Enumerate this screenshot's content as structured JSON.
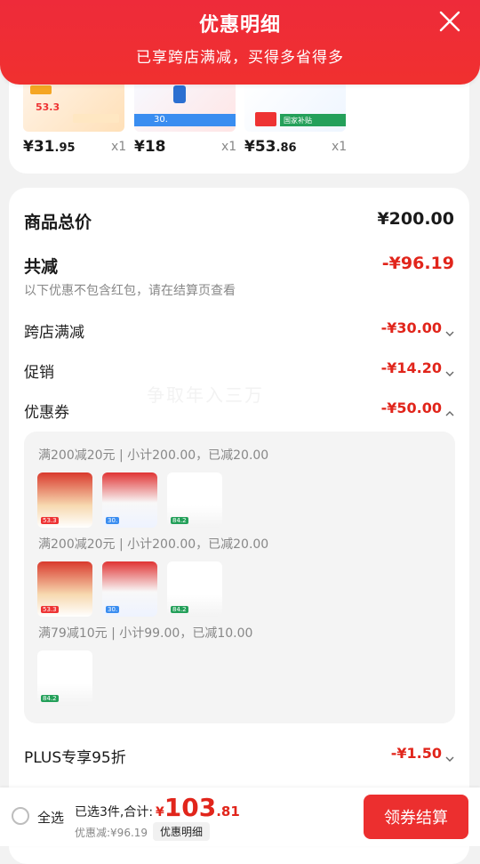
{
  "header": {
    "title": "优惠明细",
    "subtitle": "已享跨店满减，买得多省得多"
  },
  "top_products": [
    {
      "price_main": "¥31",
      "price_dec": ".95",
      "qty": "x1",
      "badge": "53.3"
    },
    {
      "price_main": "¥18",
      "price_dec": "",
      "qty": "x1",
      "badge": "30."
    },
    {
      "price_main": "¥53",
      "price_dec": ".86",
      "qty": "x1",
      "badge": "国家补贴"
    }
  ],
  "detail": {
    "total_label": "商品总价",
    "total_value": "¥200.00",
    "reduce_label": "共减",
    "reduce_value": "-¥96.19",
    "note": "以下优惠不包含红包，请在结算页查看",
    "rows": [
      {
        "label": "跨店满减",
        "value": "-¥30.00"
      },
      {
        "label": "促销",
        "value": "-¥14.20"
      },
      {
        "label": "优惠券",
        "value": "-¥50.00"
      }
    ],
    "coupon_groups": [
      {
        "title": "满200减20元 | 小计200.00，已减20.00"
      },
      {
        "title": "满200减20元 | 小计200.00，已减20.00"
      },
      {
        "title": "满79减10元 | 小计99.00，已减10.00"
      }
    ],
    "plus_label": "PLUS专享95折",
    "plus_value": "-¥1.50"
  },
  "watermark": "争取年入三万",
  "bottom": {
    "select_all": "全选",
    "selected_text": "已选3件,合计:",
    "total_cur": "¥",
    "total_int": "103",
    "total_dec": ".81",
    "discount_text": "优惠减:¥96.19",
    "detail_btn": "优惠明细",
    "checkout_btn": "领券结算"
  }
}
